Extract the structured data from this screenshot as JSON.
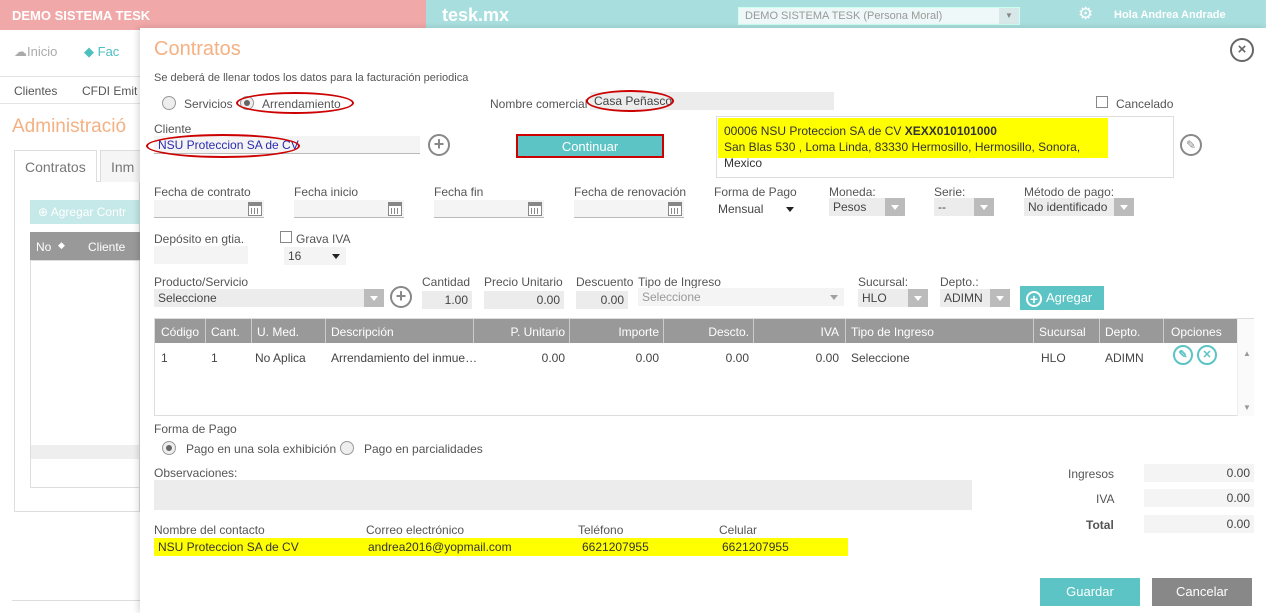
{
  "topbar": {
    "company": "DEMO SISTEMA TESK",
    "logo": "tesk.mx",
    "company_select": "DEMO SISTEMA TESK (Persona Moral)",
    "user_greeting": "Hola Andrea Andrade"
  },
  "background": {
    "nav_home": "Inicio",
    "nav_fac": "Fac",
    "sub_clientes": "Clientes",
    "sub_cfdi": "CFDI Emit",
    "admin_title": "Administració",
    "tab_contratos": "Contratos",
    "tab_inm": "Inm",
    "add_button": "Agregar Contr",
    "col_no": "No",
    "col_cliente": "Cliente"
  },
  "modal": {
    "title": "Contratos",
    "notice": "Se deberá de llenar todos los datos para la facturación periodica",
    "type_servicios": "Servicios",
    "type_arrendamiento": "Arrendamiento",
    "nombre_comercial_label": "Nombre comercial",
    "nombre_comercial_value": "Casa Peñasco",
    "cancelado_label": "Cancelado",
    "cliente_label": "Cliente",
    "cliente_value": "NSU Proteccion SA de CV",
    "continuar_label": "Continuar",
    "address_line1_prefix": "00006 NSU Proteccion SA de CV",
    "address_rfc": "XEXX010101000",
    "address_line2": "San Blas 530 , Loma Linda, 83330 Hermosillo, Hermosillo, Sonora, Mexico",
    "fecha_contrato_label": "Fecha de contrato",
    "fecha_inicio_label": "Fecha inicio",
    "fecha_fin_label": "Fecha fin",
    "fecha_renovacion_label": "Fecha de renovación",
    "forma_pago_label": "Forma de Pago",
    "forma_pago_value": "Mensual",
    "moneda_label": "Moneda:",
    "moneda_value": "Pesos",
    "serie_label": "Serie:",
    "serie_value": "--",
    "metodo_pago_label": "Método de pago:",
    "metodo_pago_value": "No identificado",
    "deposito_label": "Depósito en gtia.",
    "grava_iva_label": "Grava IVA",
    "grava_iva_value": "16",
    "producto_label": "Producto/Servicio",
    "producto_value": "Seleccione",
    "cantidad_label": "Cantidad",
    "cantidad_value": "1.00",
    "precio_label": "Precio Unitario",
    "precio_value": "0.00",
    "descuento_label": "Descuento",
    "descuento_value": "0.00",
    "tipo_ingreso_label": "Tipo de Ingreso",
    "tipo_ingreso_value": "Seleccione",
    "sucursal_label": "Sucursal:",
    "sucursal_value": "HLO",
    "depto_label": "Depto.:",
    "depto_value": "ADIMN",
    "agregar_label": "Agregar"
  },
  "grid": {
    "headers": [
      "Código",
      "Cant.",
      "U. Med.",
      "Descripción",
      "P. Unitario",
      "Importe",
      "Descto.",
      "IVA",
      "Tipo de Ingreso",
      "Sucursal",
      "Depto.",
      "Opciones"
    ],
    "rows": [
      [
        "1",
        "1",
        "No Aplica",
        "Arrendamiento del inmue…",
        "0.00",
        "0.00",
        "0.00",
        "0.00",
        "Seleccione",
        "HLO",
        "ADIMN"
      ]
    ]
  },
  "payment": {
    "label": "Forma de Pago",
    "option_una": "Pago en una sola exhibición",
    "option_parcialidades": "Pago en parcialidades",
    "observaciones_label": "Observaciones:"
  },
  "totals": {
    "ingresos_label": "Ingresos",
    "ingresos_value": "0.00",
    "iva_label": "IVA",
    "iva_value": "0.00",
    "total_label": "Total",
    "total_value": "0.00"
  },
  "contact": {
    "nombre_label": "Nombre del contacto",
    "nombre_value": "NSU Proteccion SA de CV",
    "correo_label": "Correo electrónico",
    "correo_value": "andrea2016@yopmail.com",
    "telefono_label": "Teléfono",
    "telefono_value": "6621207955",
    "celular_label": "Celular",
    "celular_value": "6621207955"
  },
  "actions": {
    "guardar": "Guardar",
    "cancelar": "Cancelar"
  }
}
